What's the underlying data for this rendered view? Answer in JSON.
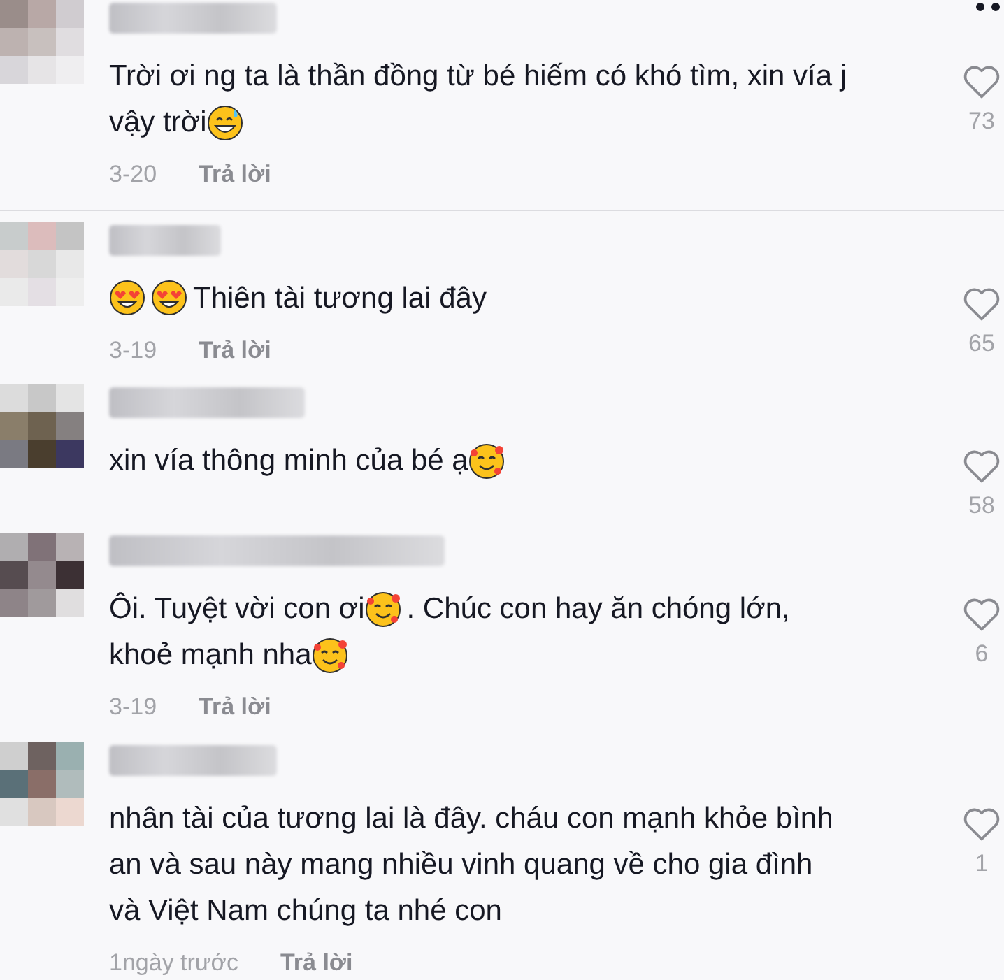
{
  "comments": [
    {
      "lines": [
        [
          {
            "kind": "text",
            "text": "Trời ơi ng ta là thần đồng từ bé hiếm có khó tìm, xin vía j"
          }
        ],
        [
          {
            "kind": "text",
            "text": "vậy trời"
          },
          {
            "kind": "sweat-smile"
          }
        ]
      ],
      "date": "3-20",
      "reply": "Trả lời",
      "likes": "73",
      "divider_after": true
    },
    {
      "lines": [
        [
          {
            "kind": "heart-eyes"
          },
          {
            "kind": "heart-eyes"
          },
          {
            "kind": "text",
            "text": "Thiên tài tương lai đây"
          }
        ]
      ],
      "date": "3-19",
      "reply": "Trả lời",
      "likes": "65",
      "divider_after": false
    },
    {
      "lines": [
        [
          {
            "kind": "text",
            "text": "xin vía thông minh của bé ạ"
          },
          {
            "kind": "smiling-hearts"
          }
        ]
      ],
      "likes": "58",
      "divider_after": false
    },
    {
      "lines": [
        [
          {
            "kind": "text",
            "text": "Ôi. Tuyệt vời con ơi"
          },
          {
            "kind": "smiling-hearts"
          },
          {
            "kind": "text",
            "text": ". Chúc con hay ăn chóng lớn,"
          }
        ],
        [
          {
            "kind": "text",
            "text": "khoẻ mạnh nha"
          },
          {
            "kind": "smiling-hearts"
          }
        ]
      ],
      "date": "3-19",
      "reply": "Trả lời",
      "likes": "6",
      "divider_after": false
    },
    {
      "lines": [
        [
          {
            "kind": "text",
            "text": "nhân tài của tương lai là đây. cháu con mạnh khỏe bình"
          }
        ],
        [
          {
            "kind": "text",
            "text": "an và sau này mang nhiều vinh quang về cho gia đình"
          }
        ],
        [
          {
            "kind": "text",
            "text": "và Việt Nam chúng ta nhé con"
          }
        ]
      ],
      "date": "1ngày trước",
      "reply": "Trả lời",
      "likes": "1",
      "divider_after": false
    }
  ]
}
